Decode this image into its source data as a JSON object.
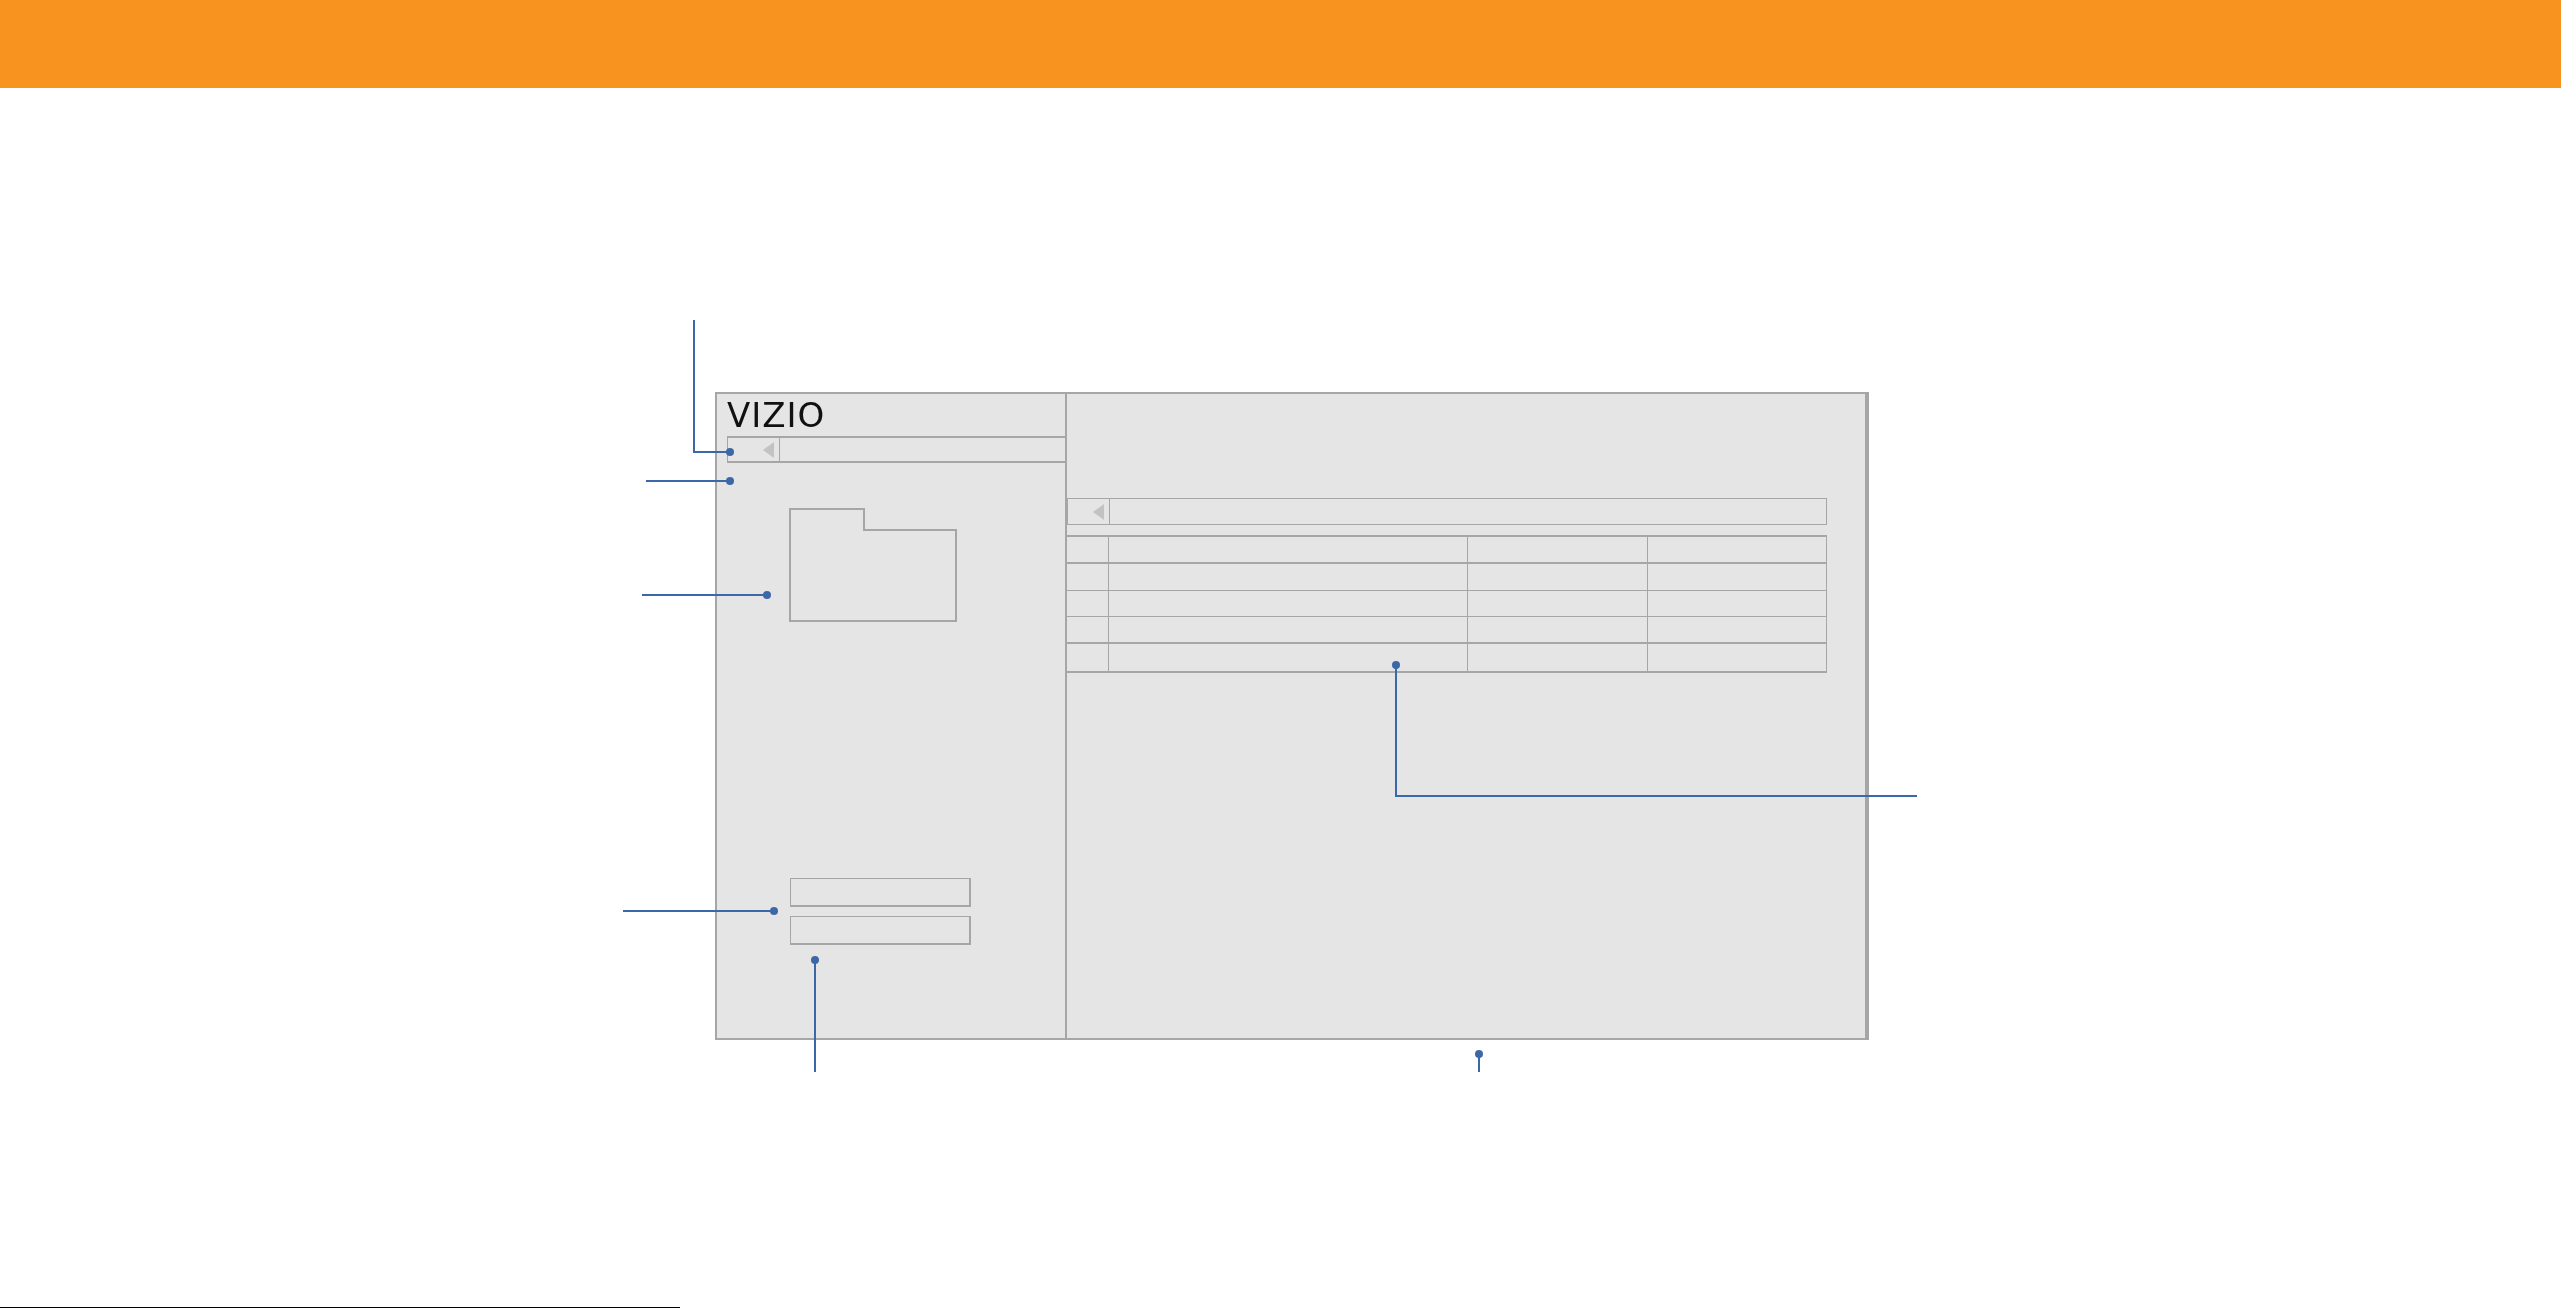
{
  "logo": {
    "text": "VIZIO"
  }
}
